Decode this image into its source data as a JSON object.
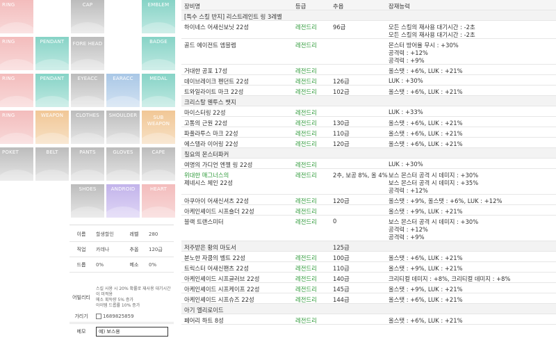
{
  "slots": [
    [
      "RING",
      "",
      "CAP",
      "",
      "EMBLEM"
    ],
    [
      "RING",
      "PENDANT",
      "FORE HEAD",
      "",
      "BADGE"
    ],
    [
      "RING",
      "PENDANT",
      "EYEACC",
      "EARACC",
      "MEDAL"
    ],
    [
      "RING",
      "WEAPON",
      "CLOTHES",
      "SHOULDER",
      "SUB WEAPON"
    ],
    [
      "POKET",
      "BELT",
      "PANTS",
      "GLOVES",
      "CAPE"
    ],
    [
      "",
      "",
      "SHOES",
      "ANDROID",
      "HEART"
    ]
  ],
  "info": {
    "name_k": "이름",
    "name_v": "할생할인",
    "level_k": "레벨",
    "level_v": "280",
    "job_k": "직업",
    "job_v": "카데나",
    "star_k": "추옵",
    "star_v": "120급",
    "drop_k": "드롭",
    "drop_v": "0%",
    "meso_k": "메소",
    "meso_v": "0%",
    "ability_k": "어빌리티",
    "ability_v": [
      "스킬 사용 시 20% 확률로 재사용 대기시간이 미적용",
      "메소 획득량 5% 증가",
      "아이템 드롭률 10% 증가"
    ],
    "gari_k": "가리기",
    "gari_v": "1689825859",
    "memo_k": "메모",
    "memo_v": "예) 보스용"
  },
  "table": {
    "headers": [
      "장비명",
      "등급",
      "추옵",
      "잠재능력"
    ],
    "rows": [
      {
        "n": "[특수 스킬 반지] 리스트레인트 링 3레벨",
        "g": "",
        "s": "",
        "p": [],
        "sec": true
      },
      {
        "n": "하이네스 어새신보닛 22성",
        "g": "레전드리",
        "s": "96급",
        "p": [
          "모든 스킬의 재사용 대기시간 : -2초",
          "모든 스킬의 재사용 대기시간 : -2초"
        ]
      },
      {
        "n": "골드 에이전트 엠블렘",
        "g": "레전드리",
        "s": "",
        "p": [
          "몬스터 방어율 무시 : +30%",
          "공격력 : +12%",
          "공격력 : +9%"
        ]
      },
      {
        "n": "거대한 공포 17성",
        "g": "레전드리",
        "s": "",
        "p": [
          "올스탯 : +6%, LUK : +21%"
        ]
      },
      {
        "n": "데이브레이크 펜던트 22성",
        "g": "레전드리",
        "s": "126급",
        "p": [
          "LUK : +30%"
        ]
      },
      {
        "n": "트와일라이트 마크 22성",
        "g": "레전드리",
        "s": "102급",
        "p": [
          "올스탯 : +6%, LUK : +21%"
        ]
      },
      {
        "n": "크리스탈 웬투스 뱃지",
        "g": "",
        "s": "",
        "p": [],
        "sec": true
      },
      {
        "n": "마이스터링 22성",
        "g": "레전드리",
        "s": "",
        "p": [
          "LUK : +33%"
        ]
      },
      {
        "n": "고통의 근원 22성",
        "g": "레전드리",
        "s": "130급",
        "p": [
          "올스탯 : +6%, LUK : +21%"
        ]
      },
      {
        "n": "파풀라투스 마크 22성",
        "g": "레전드리",
        "s": "110급",
        "p": [
          "올스탯 : +6%, LUK : +21%"
        ]
      },
      {
        "n": "에스텔라 이어링 22성",
        "g": "레전드리",
        "s": "120급",
        "p": [
          "올스탯 : +6%, LUK : +21%"
        ]
      },
      {
        "n": "칠요의 몬스터파커",
        "g": "",
        "s": "",
        "p": [],
        "sec": true
      },
      {
        "n": "여명의 가디언 엔젤 링 22성",
        "g": "레전드리",
        "s": "",
        "p": [
          "LUK : +30%"
        ]
      },
      {
        "n": "위대한 매그너스의",
        "n2": "제네시스 체인 22성",
        "g": "레전드리",
        "s": "2추, 보공 8%, 올 4%",
        "p": [
          "보스 몬스터 공격 시 데미지 : +30%",
          "보스 몬스터 공격 시 데미지 : +35%",
          "공격력 : +12%"
        ]
      },
      {
        "n": "아쿠아이 어새신셔츠 22성",
        "g": "레전드리",
        "s": "120급",
        "p": [
          "올스탯 : +9%, 올스탯 : +6%, LUK : +12%"
        ]
      },
      {
        "n": "아케인셰이드 시프숄더 22성",
        "g": "레전드리",
        "s": "",
        "p": [
          "올스탯 : +9%, LUK : +21%"
        ]
      },
      {
        "n": "블랙 트랜스미터",
        "g": "레전드리",
        "s": "0",
        "p": [
          "보스 몬스터 공격 시 데미지 : +30%",
          "공격력 : +12%",
          "공격력 : +9%"
        ]
      },
      {
        "n": "저주받은 황의 마도서",
        "g": "",
        "s": "125급",
        "p": [],
        "sec": true
      },
      {
        "n": "분노한 자쿰의 벨트 22성",
        "g": "레전드리",
        "s": "100급",
        "p": [
          "올스탯 : +6%, LUK : +21%"
        ]
      },
      {
        "n": "트릭스터 어새신팬츠 22성",
        "g": "레전드리",
        "s": "110급",
        "p": [
          "올스탯 : +9%, LUK : +21%"
        ]
      },
      {
        "n": "아케인셰이드 시프글러브 22성",
        "g": "레전드리",
        "s": "140급",
        "p": [
          "크리티컬 데미지 : +8%, 크리티컬 데미지 : +8%"
        ]
      },
      {
        "n": "아케인셰이드 시프케이프 22성",
        "g": "레전드리",
        "s": "145급",
        "p": [
          "올스탯 : +9%, LUK : +21%"
        ]
      },
      {
        "n": "아케인셰이드 시프슈즈 22성",
        "g": "레전드리",
        "s": "144급",
        "p": [
          "올스탯 : +6%, LUK : +21%"
        ]
      },
      {
        "n": "아기 엘리로이드",
        "g": "",
        "s": "",
        "p": [],
        "sec": true
      },
      {
        "n": "페어리 하트 8성",
        "g": "레전드리",
        "s": "",
        "p": [
          "올스탯 : +6%, LUK : +21%"
        ]
      }
    ]
  },
  "colors": {
    "legendary": "#2e9a39"
  }
}
